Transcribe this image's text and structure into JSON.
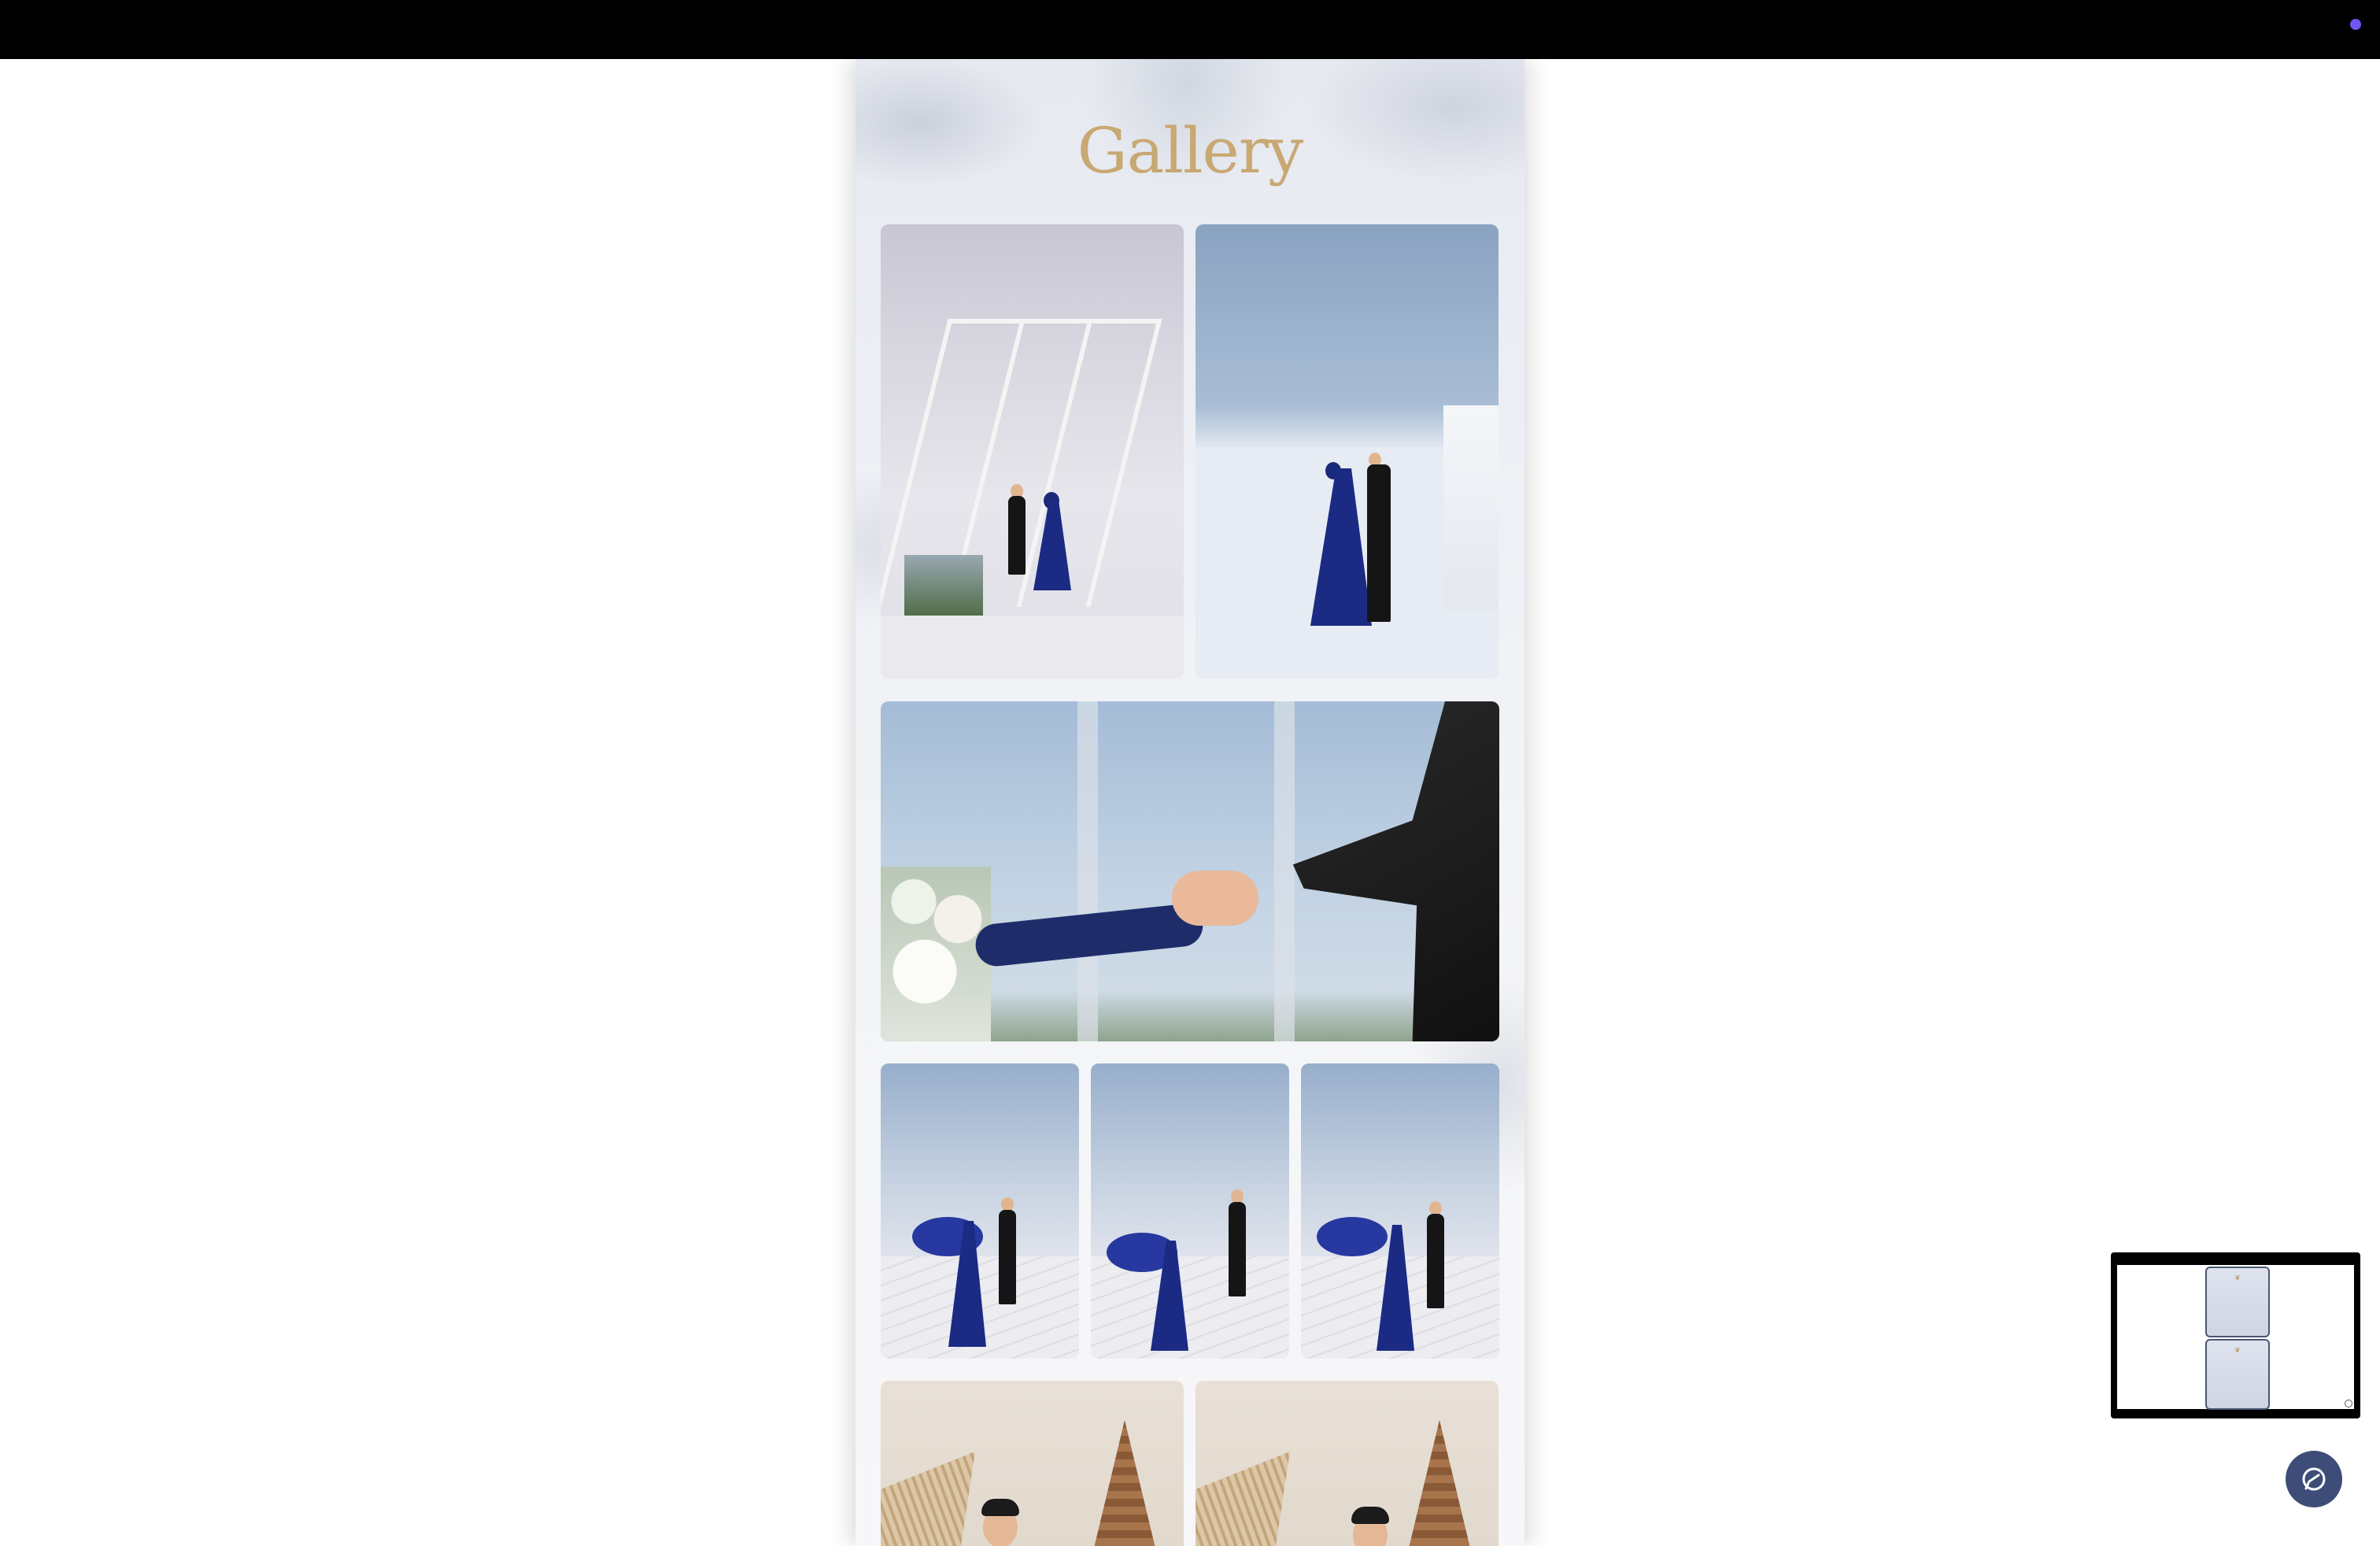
{
  "gallery": {
    "title": "Gallery",
    "title_color": "#c8a873",
    "photos": [
      {
        "name": "couple-standing-frame",
        "description_icon": "photo"
      },
      {
        "name": "couple-standing-wall",
        "description_icon": "photo"
      },
      {
        "name": "holding-hands",
        "description_icon": "photo"
      },
      {
        "name": "couple-stairs-1",
        "description_icon": "photo"
      },
      {
        "name": "couple-stairs-2",
        "description_icon": "photo"
      },
      {
        "name": "couple-stairs-3",
        "description_icon": "photo"
      },
      {
        "name": "couple-indoor-1",
        "description_icon": "photo"
      },
      {
        "name": "couple-indoor-2",
        "description_icon": "photo"
      }
    ]
  },
  "topbar": {
    "indicator_color": "#6e56f2"
  },
  "preview": {
    "icon": "preview-window"
  },
  "chat": {
    "icon": "chat-icon",
    "color": "#3d4d78"
  }
}
